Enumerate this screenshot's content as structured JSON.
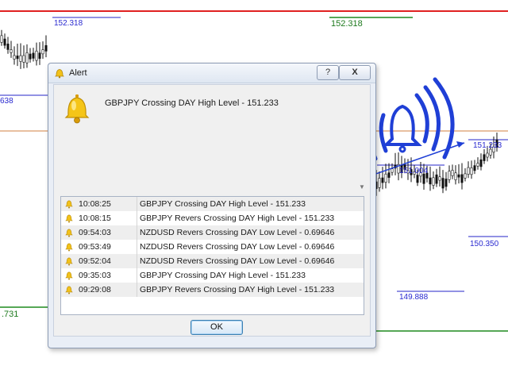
{
  "chart": {
    "price_labels": [
      "152.318",
      "152.318",
      "151.233",
      "151.004",
      "150.350",
      "149.888",
      ".731",
      "638"
    ],
    "colors": {
      "high_line": "#e02020",
      "low_line": "#1e8a1e",
      "level_line": "#2424c8",
      "annotation": "#1f3fd6"
    }
  },
  "dialog": {
    "title": "Alert",
    "title_icon": "bell-icon",
    "help_label": "?",
    "close_label": "X",
    "message": "GBPJPY Crossing DAY High Level - 151.233",
    "ok_label": "OK",
    "alerts": [
      {
        "time": "10:08:25",
        "text": "GBPJPY Crossing DAY High Level - 151.233"
      },
      {
        "time": "10:08:15",
        "text": "GBPJPY Revers Crossing DAY High Level - 151.233"
      },
      {
        "time": "09:54:03",
        "text": "NZDUSD Revers Crossing DAY Low Level - 0.69646"
      },
      {
        "time": "09:53:49",
        "text": "NZDUSD Revers Crossing DAY Low Level - 0.69646"
      },
      {
        "time": "09:52:04",
        "text": "NZDUSD Revers Crossing DAY Low Level - 0.69646"
      },
      {
        "time": "09:35:03",
        "text": "GBPJPY Crossing DAY High Level - 151.233"
      },
      {
        "time": "09:29:08",
        "text": "GBPJPY Revers Crossing DAY High Level - 151.233"
      }
    ]
  }
}
